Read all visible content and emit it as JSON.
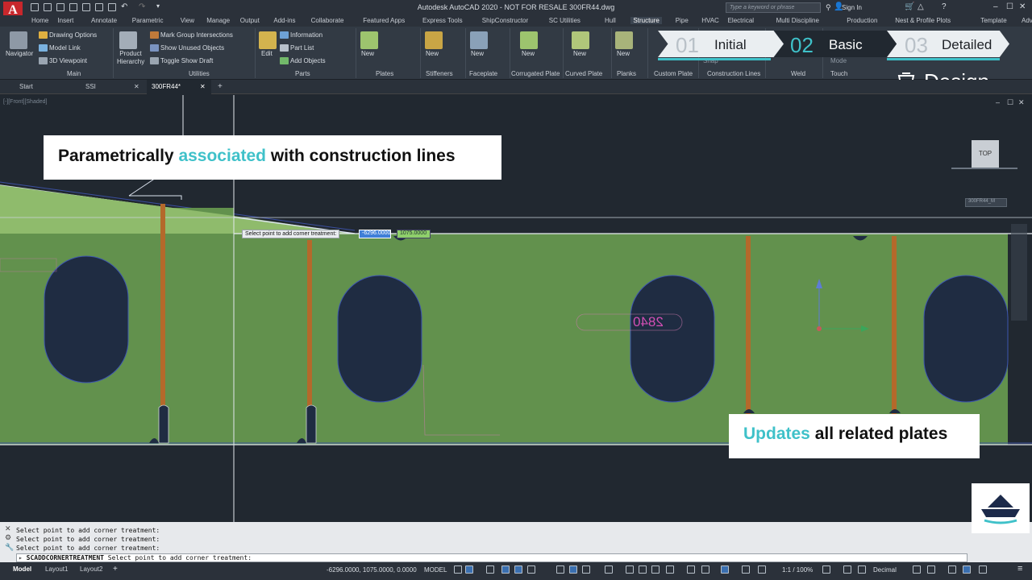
{
  "window": {
    "title": "Autodesk AutoCAD 2020 - NOT FOR RESALE   300FR44.dwg",
    "search_placeholder": "Type a keyword or phrase",
    "sign_in": "Sign In"
  },
  "ribbon_tabs": [
    "Home",
    "Insert",
    "Annotate",
    "Parametric",
    "View",
    "Manage",
    "Output",
    "Add-ins",
    "Collaborate",
    "Featured Apps",
    "Express Tools",
    "ShipConstructor",
    "SC Utilities",
    "Hull",
    "Structure",
    "Pipe",
    "HVAC",
    "Electrical",
    "Multi Discipline",
    "Production",
    "Nest & Profile Plots",
    "Template",
    "Advantage Pack"
  ],
  "active_tab": "Structure",
  "ribbon": {
    "navigator": "Navigator",
    "drawing_options": "Drawing Options",
    "model_link": "Model Link",
    "viewpoint_3d": "3D Viewpoint",
    "product_hierarchy": "Product\nHierarchy",
    "mark_group": "Mark Group Intersections",
    "show_unused": "Show Unused Objects",
    "toggle_show_draft": "Toggle Show Draft",
    "edit": "Edit",
    "information": "Information",
    "part_list": "Part List",
    "add_objects": "Add Objects",
    "new": "New",
    "groups": [
      "Main",
      "Utilities",
      "Parts",
      "Plates",
      "Stiffeners",
      "Faceplate",
      "Corrugated Plate",
      "Curved Plate",
      "Planks",
      "Custom Plate",
      "Construction Lines",
      "Weld",
      "Touch"
    ],
    "snap_label": "Snap",
    "mode_label": "Mode"
  },
  "steps": [
    {
      "num": "01",
      "label": "Initial"
    },
    {
      "num": "02",
      "label": "Basic"
    },
    {
      "num": "03",
      "label": "Detailed"
    }
  ],
  "design_label": "Design",
  "file_tabs": [
    "Start",
    "SSI",
    "300FR44*"
  ],
  "viewport_label": "[-][Front][Shaded]",
  "viewcube": {
    "top": "TOP",
    "tag": "300FR44_M"
  },
  "canvas": {
    "prompt": "Select point to add corner treatment:",
    "coord_x": "-6296.0000",
    "coord_y": "1075.0000",
    "dimension_text": "2840"
  },
  "callouts": {
    "top_pre": "Parametrically ",
    "top_accent": "associated",
    "top_post": " with construction lines",
    "bottom_accent": "Updates",
    "bottom_post": " all related plates"
  },
  "command": {
    "history": [
      "Select point to add corner treatment:",
      "Select point to add corner treatment:",
      "Select point to add corner treatment:"
    ],
    "current_cmd": "SCADDCORNERTREATMENT",
    "current_prompt": "Select point to add corner treatment:"
  },
  "status": {
    "tabs": [
      "Model",
      "Layout1",
      "Layout2"
    ],
    "coords": "-6296.0000, 1075.0000, 0.0000",
    "model": "MODEL",
    "scale": "1:1 / 100%",
    "units": "Decimal"
  },
  "colors": {
    "plate": "#62914d",
    "plate_light": "#8fbb6c",
    "hole": "#1f2c42",
    "stiffener": "#b4692b",
    "accent": "#3fc1c9",
    "canvas_bg": "#212830"
  }
}
